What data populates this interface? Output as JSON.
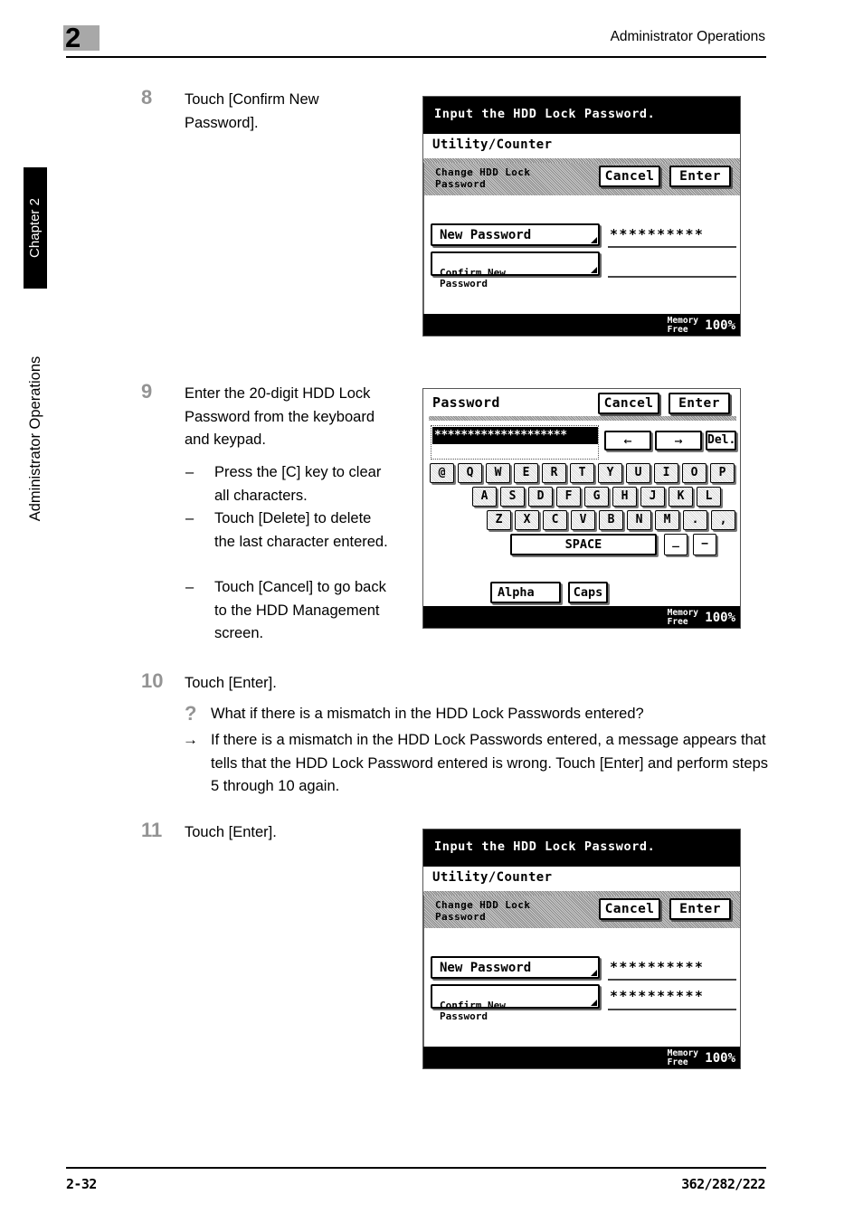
{
  "header": {
    "chapter_number": "2",
    "title": "Administrator Operations"
  },
  "sidebar": {
    "tab_label": "Chapter 2",
    "vertical_title": "Administrator Operations"
  },
  "footer": {
    "page_number": "2-32",
    "model_numbers": "362/282/222"
  },
  "steps": [
    {
      "number": "8",
      "text": "Touch [Confirm New Password]."
    },
    {
      "number": "9",
      "text": "Enter the 20-digit HDD Lock Password from the keyboard and keypad.",
      "bullets": [
        {
          "dash": "–",
          "text": "Press the [C] key to clear all characters."
        },
        {
          "dash": "–",
          "text": "Touch [Delete] to delete the last character entered."
        },
        {
          "dash": "–",
          "text": "Touch [Cancel] to go back to the HDD Management screen."
        }
      ]
    },
    {
      "number": "10",
      "text": "Touch [Enter].",
      "note": {
        "question_icon": "?",
        "question": "What if there is a mismatch in the HDD Lock Passwords entered?",
        "arrow_icon": "→",
        "answer": "If there is a mismatch in the HDD Lock Passwords entered, a message appears that tells that the HDD Lock Password entered is wrong. Touch [Enter] and perform steps 5 through 10 again."
      }
    },
    {
      "number": "11",
      "text": "Touch [Enter]."
    }
  ],
  "screens": {
    "hdd_password_empty": {
      "titlebar": "Input the HDD Lock Password.",
      "subtitle": "Utility/Counter",
      "tab_label": "Change HDD Lock\nPassword",
      "cancel_label": "Cancel",
      "enter_label": "Enter",
      "new_password_label": "New Password",
      "new_password_value": "**********",
      "confirm_label": "Confirm New\nPassword",
      "confirm_value": "",
      "memory_label": "Memory\nFree",
      "memory_percent": "100%"
    },
    "keyboard": {
      "title": "Password",
      "cancel_label": "Cancel",
      "enter_label": "Enter",
      "input_value": "********************",
      "left_arrow": "←",
      "right_arrow": "→",
      "delete_label": "Del.",
      "rows": [
        [
          "@",
          "Q",
          "W",
          "E",
          "R",
          "T",
          "Y",
          "U",
          "I",
          "O",
          "P"
        ],
        [
          "A",
          "S",
          "D",
          "F",
          "G",
          "H",
          "J",
          "K",
          "L"
        ],
        [
          "Z",
          "X",
          "C",
          "V",
          "B",
          "N",
          "M",
          ".",
          ","
        ]
      ],
      "space_label": "SPACE",
      "underscore_label": "_",
      "hyphen_label": "−",
      "alpha_label": "Alpha",
      "caps_label": "Caps",
      "memory_label": "Memory\nFree",
      "memory_percent": "100%"
    },
    "hdd_password_filled": {
      "titlebar": "Input the HDD Lock Password.",
      "subtitle": "Utility/Counter",
      "tab_label": "Change HDD Lock\nPassword",
      "cancel_label": "Cancel",
      "enter_label": "Enter",
      "new_password_label": "New Password",
      "new_password_value": "**********",
      "confirm_label": "Confirm New\nPassword",
      "confirm_value": "**********",
      "memory_label": "Memory\nFree",
      "memory_percent": "100%"
    }
  }
}
